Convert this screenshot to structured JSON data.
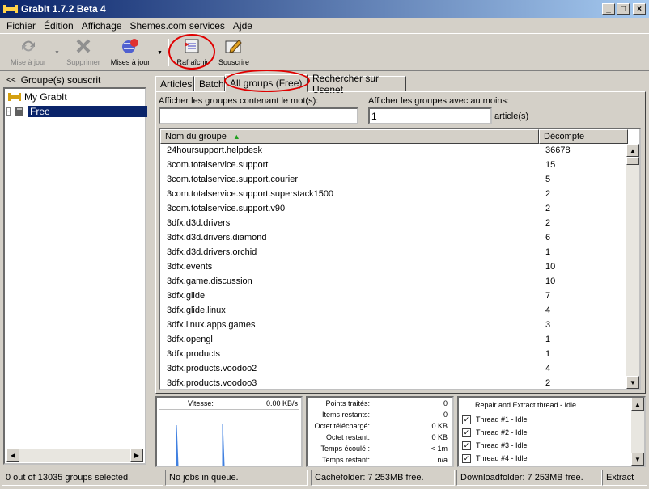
{
  "window": {
    "title": "GrabIt 1.7.2 Beta 4"
  },
  "menu": [
    "Fichier",
    "Édition",
    "Affichage",
    "Shemes.com services",
    "Ajde"
  ],
  "toolbar": {
    "mise_a_jour": "Mise à jour",
    "supprimer": "Supprimer",
    "mises_a_jour": "Mises à jour",
    "rafraichir": "Rafraîchir",
    "souscrire": "Souscrire"
  },
  "left_panel": {
    "header": "Groupe(s) souscrit",
    "collapse": "<<",
    "tree": [
      {
        "label": "My GrabIt"
      },
      {
        "label": "Free",
        "expander": "-"
      }
    ]
  },
  "tabs": [
    "Articles",
    "Batch",
    "All groups (Free)",
    "Rechercher sur Usenet"
  ],
  "filter": {
    "contains_label": "Afficher les groupes contenant le mot(s):",
    "contains_value": "",
    "atleast_label": "Afficher les groupes avec au moins:",
    "atleast_value": "1",
    "unit": "article(s)"
  },
  "list": {
    "columns": [
      "Nom du groupe",
      "Décompte"
    ],
    "rows": [
      [
        "24hoursupport.helpdesk",
        "36678"
      ],
      [
        "3com.totalservice.support",
        "15"
      ],
      [
        "3com.totalservice.support.courier",
        "5"
      ],
      [
        "3com.totalservice.support.superstack1500",
        "2"
      ],
      [
        "3com.totalservice.support.v90",
        "2"
      ],
      [
        "3dfx.d3d.drivers",
        "2"
      ],
      [
        "3dfx.d3d.drivers.diamond",
        "6"
      ],
      [
        "3dfx.d3d.drivers.orchid",
        "1"
      ],
      [
        "3dfx.events",
        "10"
      ],
      [
        "3dfx.game.discussion",
        "10"
      ],
      [
        "3dfx.glide",
        "7"
      ],
      [
        "3dfx.glide.linux",
        "4"
      ],
      [
        "3dfx.linux.apps.games",
        "3"
      ],
      [
        "3dfx.opengl",
        "1"
      ],
      [
        "3dfx.products",
        "1"
      ],
      [
        "3dfx.products.voodoo2",
        "4"
      ],
      [
        "3dfx.products.voodoo3",
        "2"
      ]
    ]
  },
  "speed": {
    "label": "Vitesse:",
    "value": "0.00 KB/s"
  },
  "stats": [
    {
      "label": "Points traités:",
      "value": "0"
    },
    {
      "label": "Items restants:",
      "value": "0"
    },
    {
      "label": "Octet téléchargé:",
      "value": "0 KB"
    },
    {
      "label": "Octet restant:",
      "value": "0 KB"
    },
    {
      "label": "Temps écoulé :",
      "value": "< 1m"
    },
    {
      "label": "Temps restant:",
      "value": "n/a"
    }
  ],
  "threads": {
    "header": "Repair and Extract thread - Idle",
    "items": [
      "Thread #1 - Idle",
      "Thread #2 - Idle",
      "Thread #3 - Idle",
      "Thread #4 - Idle"
    ]
  },
  "status": {
    "selection": "0 out of 13035 groups selected.",
    "jobs": "No jobs in queue.",
    "cache": "Cachefolder: 7 253MB free.",
    "download": "Downloadfolder: 7 253MB free.",
    "extract": "Extract"
  },
  "colors": {
    "highlight": "#e00000",
    "selection": "#0a246a"
  }
}
